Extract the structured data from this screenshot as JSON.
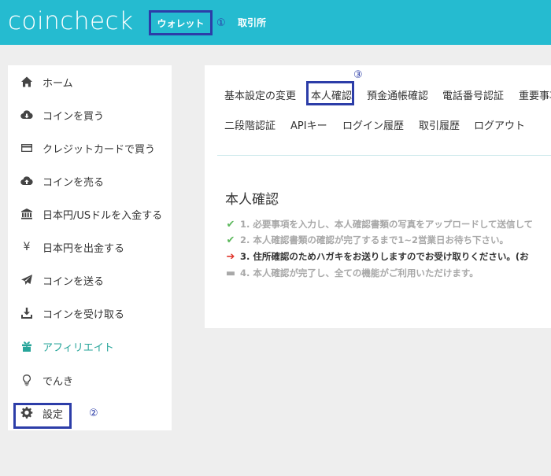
{
  "header": {
    "logo": "coincheck",
    "nav": {
      "wallet": "ウォレット",
      "exchange": "取引所"
    }
  },
  "annotations": {
    "one": "①",
    "two": "②",
    "three": "③"
  },
  "sidebar": {
    "items": [
      {
        "label": "ホーム",
        "icon": "home-icon"
      },
      {
        "label": "コインを買う",
        "icon": "cloud-download-icon"
      },
      {
        "label": "クレジットカードで買う",
        "icon": "credit-card-icon"
      },
      {
        "label": "コインを売る",
        "icon": "cloud-upload-icon"
      },
      {
        "label": "日本円/USドルを入金する",
        "icon": "bank-icon"
      },
      {
        "label": "日本円を出金する",
        "icon": "yen-icon"
      },
      {
        "label": "コインを送る",
        "icon": "paper-plane-icon"
      },
      {
        "label": "コインを受け取る",
        "icon": "download-icon"
      },
      {
        "label": "アフィリエイト",
        "icon": "gift-icon"
      },
      {
        "label": "でんき",
        "icon": "lightbulb-icon"
      },
      {
        "label": "設定",
        "icon": "gear-icon"
      }
    ]
  },
  "tabs": {
    "row1": [
      "基本設定の変更",
      "本人確認",
      "預金通帳確認",
      "電話番号認証",
      "重要事項"
    ],
    "row2": [
      "二段階認証",
      "APIキー",
      "ログイン履歴",
      "取引履歴",
      "ログアウト"
    ]
  },
  "main": {
    "title": "本人確認",
    "steps": [
      {
        "status": "done",
        "text": "1. 必要事項を入力し、本人確認書類の写真をアップロードして送信して"
      },
      {
        "status": "done",
        "text": "2. 本人確認書類の確認が完了するまで1~2営業日お待ち下さい。"
      },
      {
        "status": "current",
        "text": "3. 住所確認のためハガキをお送りしますのでお受け取りください。(お"
      },
      {
        "status": "todo",
        "text": "4. 本人確認が完了し、全ての機能がご利用いただけます。"
      }
    ]
  },
  "colors": {
    "header_bg": "#25bbd0",
    "annotation_blue": "#2c3da8",
    "active_teal": "#27a59a",
    "check_green": "#5cb85c",
    "arrow_red": "#e0352b"
  }
}
